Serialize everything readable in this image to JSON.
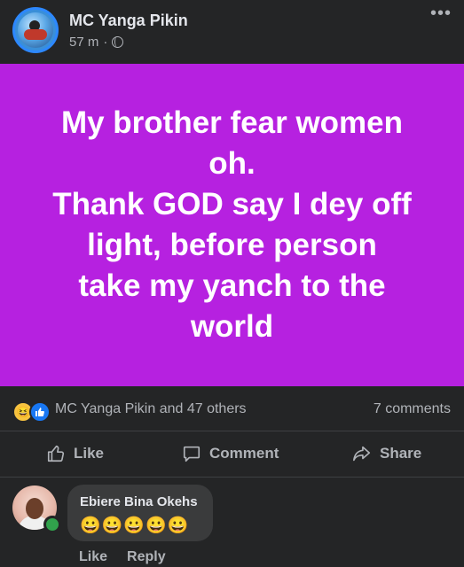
{
  "header": {
    "author": "MC Yanga Pikin",
    "time": "57 m",
    "separator": "·"
  },
  "post": {
    "text": "My brother fear women oh.\nThank GOD say I dey off light, before person take my yanch to the world",
    "background_color": "#b621e0"
  },
  "reactions": {
    "icons": [
      "haha-icon",
      "like-icon"
    ],
    "summary": "MC Yanga Pikin and 47 others",
    "comments": "7 comments"
  },
  "actions": {
    "like": "Like",
    "comment": "Comment",
    "share": "Share"
  },
  "comment": {
    "author": "Ebiere Bina Okehs",
    "text": "😀😀😀😀😀",
    "like": "Like",
    "reply": "Reply"
  }
}
